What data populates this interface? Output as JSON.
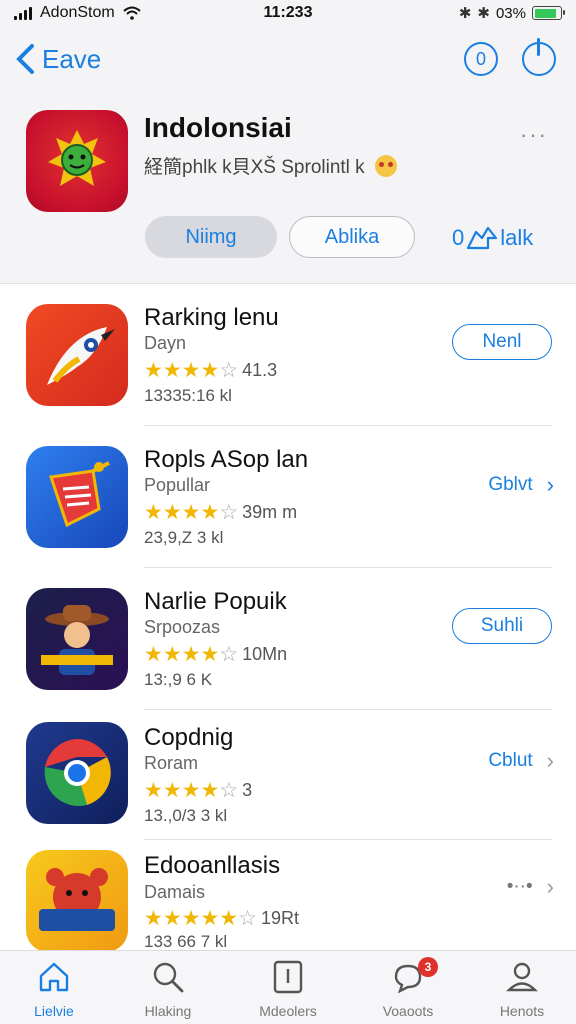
{
  "status_bar": {
    "carrier": "AdonStom",
    "time": "11:233",
    "battery": "03%",
    "battery_level": 0.85
  },
  "header": {
    "back_label": "Eave",
    "featured": {
      "title": "Indolonsiai",
      "subtitle": "経簡phlk k貝XŠ Sprolintl k",
      "button_primary": "Niimg",
      "button_secondary": "Ablika",
      "share_prefix": "0",
      "share_label": "lalk"
    }
  },
  "apps": [
    {
      "name": "Rarking lenu",
      "category": "Dayn",
      "stars": 3.5,
      "rating": "41.3",
      "downloads": "13335:16 kl",
      "action": "Nenl",
      "action_style": "button"
    },
    {
      "name": "Ropls ASop lan",
      "category": "Popullar",
      "stars": 3.5,
      "rating": "39m m",
      "downloads": "23,9,Z 3 kl",
      "action": "Gblvt",
      "action_style": "link"
    },
    {
      "name": "Narlie Popuik",
      "category": "Srpoozas",
      "stars": 3.5,
      "rating": "10Mn",
      "downloads": "13:,9 6 K",
      "action": "Suhli",
      "action_style": "button"
    },
    {
      "name": "Copdnig",
      "category": "Roram",
      "stars": 3.5,
      "rating": "3",
      "downloads": "13.,0/3 3 kl",
      "action": "Cblut",
      "action_style": "link-gray"
    },
    {
      "name": "Edooanllasis",
      "category": "Damais",
      "stars": 4.5,
      "rating": "19Rt",
      "downloads": "133 66 7 kl",
      "action": "•··•",
      "action_style": "dots"
    }
  ],
  "tabs": [
    {
      "label": "Lielvie",
      "icon": "home-icon",
      "active": true
    },
    {
      "label": "Hlaking",
      "icon": "search-icon",
      "active": false
    },
    {
      "label": "Mdeolers",
      "icon": "box-icon",
      "active": false
    },
    {
      "label": "Voaoots",
      "icon": "chat-icon",
      "active": false,
      "badge": "3"
    },
    {
      "label": "Henots",
      "icon": "person-icon",
      "active": false
    }
  ],
  "colors": {
    "accent": "#1a7fe0",
    "star": "#f2b705",
    "badge": "#e0302a"
  }
}
